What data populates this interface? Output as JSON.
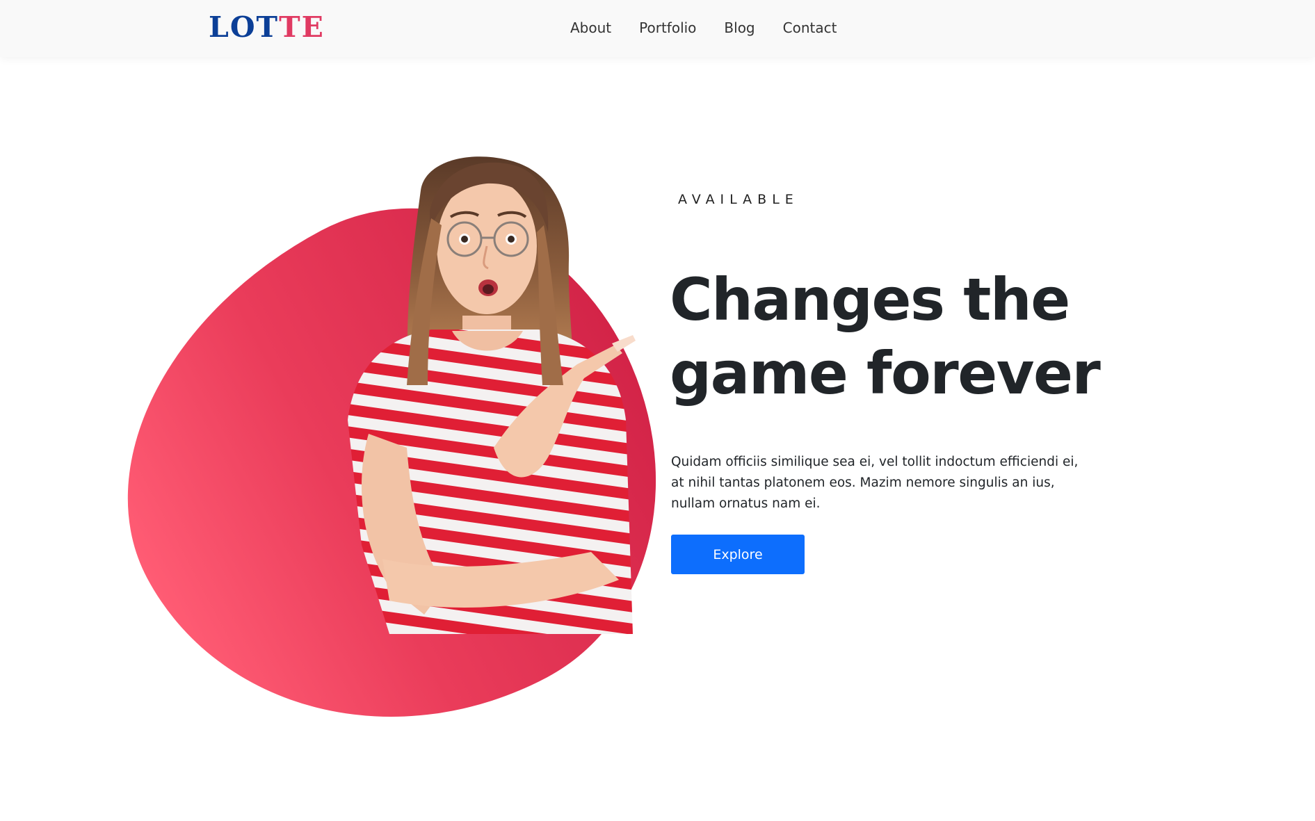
{
  "brand": {
    "logo_part1": "LOT",
    "logo_part2": "TE",
    "primary_color": "#0c3f97",
    "accent_color": "#e03a62"
  },
  "nav": {
    "items": [
      {
        "label": "About"
      },
      {
        "label": "Portfolio"
      },
      {
        "label": "Blog"
      },
      {
        "label": "Contact"
      }
    ]
  },
  "hero": {
    "eyebrow": "AVAILABLE",
    "headline_line1": "Changes the",
    "headline_line2": "game forever",
    "description": "Quidam officiis similique sea ei, vel tollit indoctum efficiendi ei, at nihil tantas platonem eos. Mazim nemore singulis an ius, nullam ornatus nam ei.",
    "cta_label": "Explore",
    "cta_color": "#0d6efd",
    "blob_color": "#e8385a"
  }
}
